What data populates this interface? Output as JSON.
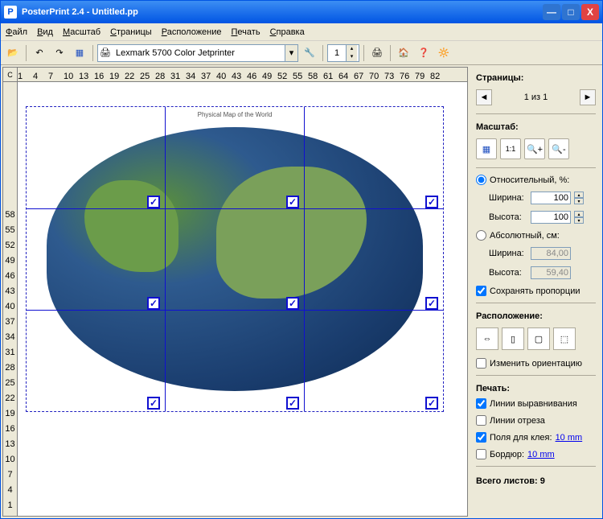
{
  "title": "PosterPrint 2.4 - Untitled.pp",
  "menu": [
    "Файл",
    "Вид",
    "Масштаб",
    "Страницы",
    "Расположение",
    "Печать",
    "Справка"
  ],
  "printer": "Lexmark 5700 Color Jetprinter",
  "copies": "1",
  "ruler_corner": "C",
  "hruler": [
    "1",
    "4",
    "7",
    "10",
    "13",
    "16",
    "19",
    "22",
    "25",
    "28",
    "31",
    "34",
    "37",
    "40",
    "43",
    "46",
    "49",
    "52",
    "55",
    "58",
    "61",
    "64",
    "67",
    "70",
    "73",
    "76",
    "79",
    "82"
  ],
  "vruler": [
    "1",
    "4",
    "7",
    "10",
    "13",
    "16",
    "19",
    "22",
    "25",
    "28",
    "31",
    "34",
    "37",
    "40",
    "43",
    "46",
    "49",
    "52",
    "55",
    "58"
  ],
  "map_title": "Physical Map of the World",
  "sidebar": {
    "pages_title": "Страницы:",
    "page_of": "1 из 1",
    "zoom_title": "Масштаб:",
    "scale_relative": "Относительный, %:",
    "scale_absolute": "Абсолютный, см:",
    "width_label": "Ширина:",
    "height_label": "Высота:",
    "rel_width": "100",
    "rel_height": "100",
    "abs_width": "84,00",
    "abs_height": "59,40",
    "keep_aspect": "Сохранять пропорции",
    "layout_title": "Расположение:",
    "change_orient": "Изменить ориентацию",
    "print_title": "Печать:",
    "align_lines": "Линии выравнивания",
    "cut_lines": "Линии отреза",
    "glue_margins": "Поля для клея:",
    "glue_value": "10 mm",
    "border": "Бордюр:",
    "border_value": "10 mm",
    "total_label": "Всего листов:",
    "total_value": "9"
  }
}
